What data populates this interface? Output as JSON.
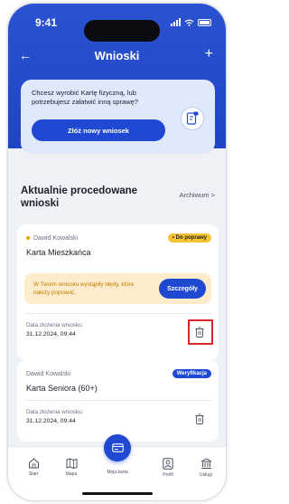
{
  "status": {
    "time": "9:41"
  },
  "nav": {
    "title": "Wnioski",
    "back_icon": "arrow-left-icon",
    "add_icon": "plus-icon"
  },
  "promo": {
    "text": "Chcesz wyrobić Kartę fizyczną, lub potrzebujesz załatwić inną sprawę?",
    "button": "Złóż nowy wniosek",
    "icon": "document-card-icon"
  },
  "section": {
    "title": "Aktualnie procedowane wnioski",
    "archive_link": "Archiwum  >"
  },
  "applications": [
    {
      "owner": "Dawid Kowalski",
      "title": "Karta Mieszkańca",
      "badge": "• Do poprawy",
      "warning": "W Twoim wniosku wystąpiły błędy, które należy poprawić.",
      "details_button": "Szczegóły",
      "date_label": "Data złożenia wniosku:",
      "date": "31.12.2024, 09:44",
      "colors": {
        "badge": "#f6c430",
        "warning_bg": "#fdeccb"
      }
    },
    {
      "owner": "Dawid Kowalski",
      "title": "Karta Seniora (60+)",
      "badge": "Weryfikacja",
      "date_label": "Data złożenia wniosku:",
      "date": "31.12.2024, 09:44",
      "colors": {
        "badge": "#1f49d3"
      }
    }
  ],
  "tabbar": {
    "items": [
      {
        "label": "Start",
        "icon": "home-icon"
      },
      {
        "label": "Mapa",
        "icon": "map-icon"
      },
      {
        "label": "Moja karta",
        "icon": "card-icon"
      },
      {
        "label": "Profil",
        "icon": "profile-icon"
      },
      {
        "label": "Usługi",
        "icon": "bank-icon"
      }
    ]
  },
  "colors": {
    "primary": "#1f49d3",
    "highlight": "#d9262c"
  }
}
